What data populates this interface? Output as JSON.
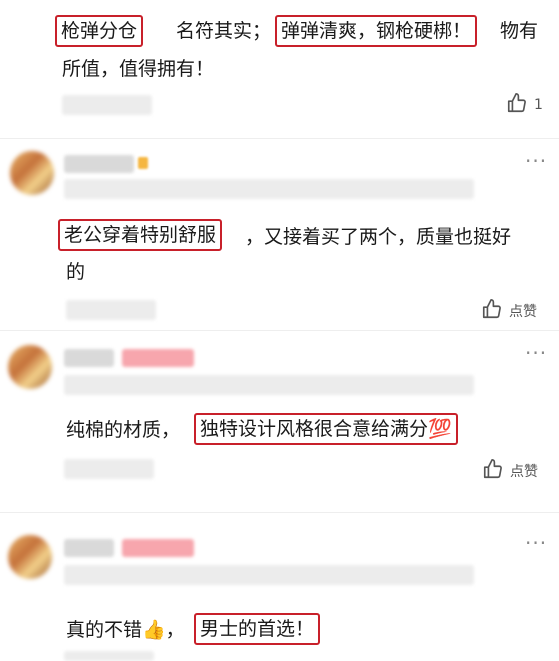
{
  "comments": [
    {
      "segments": [
        "枪弹分仓",
        "名符其实；",
        "弹弹清爽，钢枪硬梆！",
        "物有",
        "所值，值得拥有！"
      ],
      "like_label": "1"
    },
    {
      "segments": [
        "老公穿着特别舒服",
        "，又接着买了两个，质量也挺好",
        "的"
      ],
      "like_label": "点赞",
      "more": "···"
    },
    {
      "segments": [
        "纯棉的材质，",
        "独特设计风格很合意给满分💯"
      ],
      "like_label": "点赞",
      "more": "···"
    },
    {
      "segments": [
        "真的不错👍，",
        "男士的首选！"
      ],
      "more": "···"
    }
  ],
  "icons": {
    "like": "thumbs-up-icon",
    "more": "more-dots-icon"
  },
  "colors": {
    "highlight_border": "#c8202a",
    "text": "#1a1a1a",
    "muted": "#555555"
  }
}
